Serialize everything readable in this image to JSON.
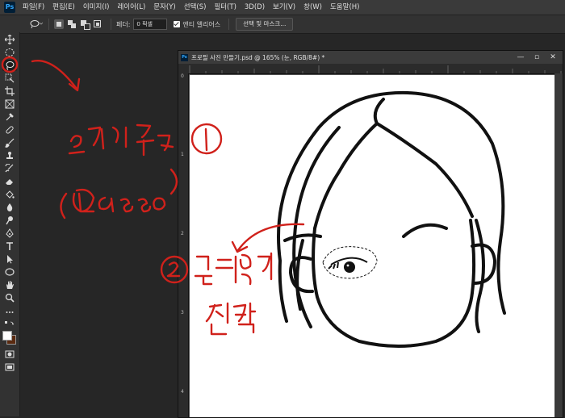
{
  "app": {
    "logo": "Ps"
  },
  "menu": {
    "items": [
      "파일(F)",
      "편집(E)",
      "이미지(I)",
      "레이어(L)",
      "문자(Y)",
      "선택(S)",
      "필터(T)",
      "3D(D)",
      "보기(V)",
      "창(W)",
      "도움말(H)"
    ]
  },
  "options": {
    "feather_label": "페더:",
    "feather_value": "0 픽셀",
    "antialias_label": "앤티 앨리어스",
    "select_mask_button": "선택 및 마스크..."
  },
  "toolbar": {
    "active_tool": "lasso-tool",
    "foreground_color": "#ffffff",
    "background_color": "#5a2a10"
  },
  "document": {
    "title": "프로필 사진 만들기.psd @ 165% (눈, RGB/8#) *",
    "ruler_left_marks": [
      "0",
      "1",
      "2",
      "3",
      "4"
    ],
    "window_controls": [
      "—",
      "▫",
      "✕"
    ]
  }
}
